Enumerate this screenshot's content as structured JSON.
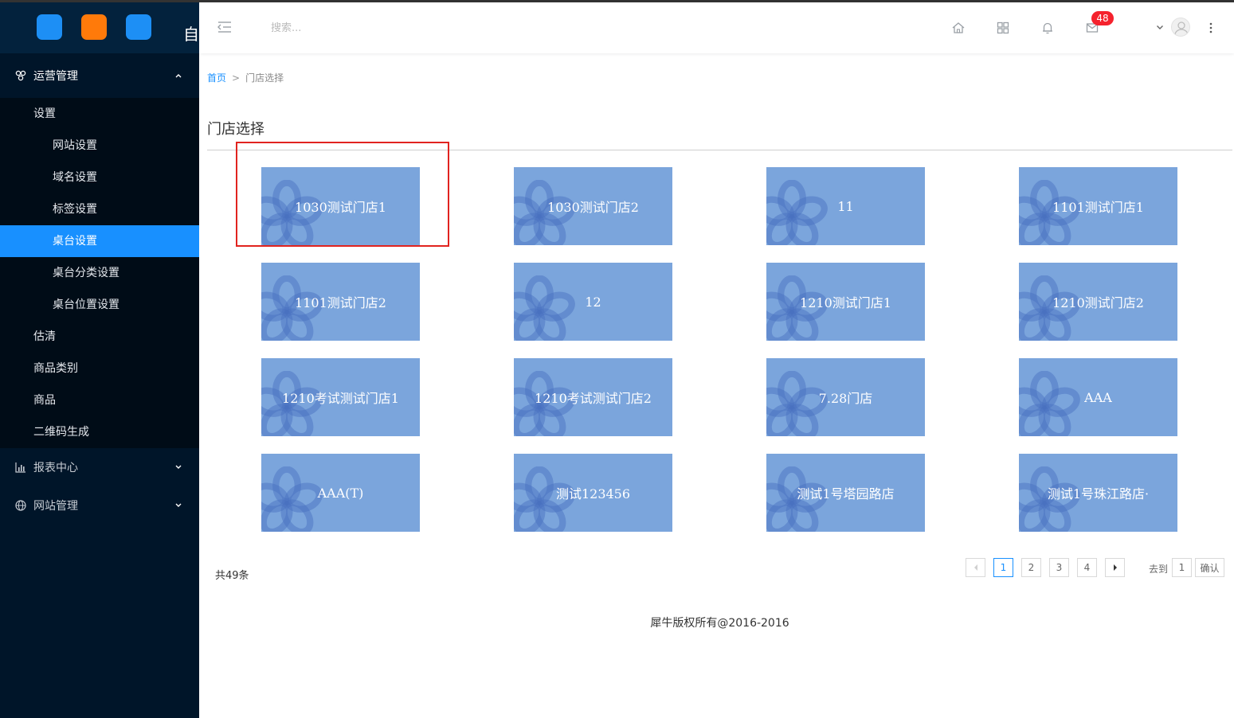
{
  "sidebar": {
    "head_char": "自",
    "groups": [
      {
        "label": "运营管理",
        "icon": "apps-icon"
      },
      {
        "label": "报表中心",
        "icon": "bar-chart-icon"
      },
      {
        "label": "网站管理",
        "icon": "globe-icon"
      }
    ],
    "submenu": {
      "title": "设置",
      "items": [
        "网站设置",
        "域名设置",
        "标签设置",
        "桌台设置",
        "桌台分类设置",
        "桌台位置设置"
      ],
      "active_index": 3,
      "extra": [
        "估清",
        "商品类别",
        "商品",
        "二维码生成"
      ]
    }
  },
  "header": {
    "search_placeholder": "搜索...",
    "badge_count": "48"
  },
  "breadcrumb": {
    "home": "首页",
    "separator": ">",
    "current": "门店选择"
  },
  "page_title": "门店选择",
  "stores": [
    "1030测试门店1",
    "1030测试门店2",
    "11",
    "1101测试门店1",
    "1101测试门店2",
    "12",
    "1210测试门店1",
    "1210测试门店2",
    "1210考试测试门店1",
    "1210考试测试门店2",
    "7.28门店",
    "AAA",
    "AAA(T)",
    "测试123456",
    "测试1号塔园路店",
    "测试1号珠江路店·"
  ],
  "pagination": {
    "total_text": "共49条",
    "pages": [
      "1",
      "2",
      "3",
      "4"
    ],
    "current_page": "1",
    "goto_label": "去到",
    "goto_value": "1",
    "confirm_label": "确认"
  },
  "footer": "犀牛版权所有@2016-2016",
  "colors": {
    "sidebar_bg": "#001529",
    "active": "#1890ff",
    "tile": "#7ba5dc",
    "highlight": "#e1231f",
    "badge": "#f5222d"
  }
}
